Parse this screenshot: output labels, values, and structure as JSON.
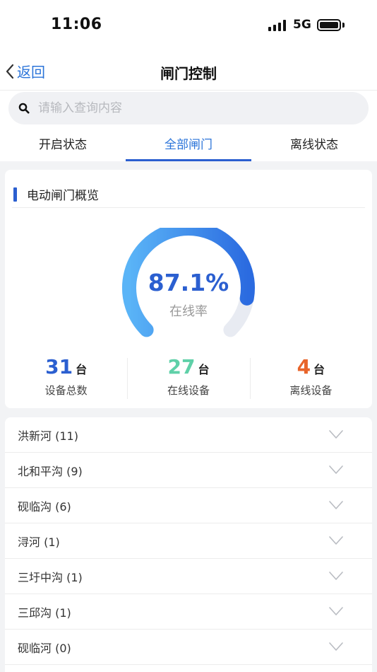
{
  "status_bar": {
    "time": "11:06",
    "network": "5G"
  },
  "nav": {
    "back_label": "返回",
    "title": "闸门控制"
  },
  "search": {
    "placeholder": "请输入查询内容"
  },
  "tabs": [
    {
      "label": "开启状态"
    },
    {
      "label": "全部闸门",
      "active": true
    },
    {
      "label": "离线状态"
    }
  ],
  "overview": {
    "title": "电动闸门概览",
    "gauge": {
      "value_text": "87.1%",
      "fraction": 0.871,
      "label": "在线率"
    },
    "stats": [
      {
        "value": "31",
        "unit": "台",
        "label": "设备总数",
        "color": "#2b5fd0"
      },
      {
        "value": "27",
        "unit": "台",
        "label": "在线设备",
        "color": "#5fd0a8"
      },
      {
        "value": "4",
        "unit": "台",
        "label": "离线设备",
        "color": "#e8642a"
      }
    ]
  },
  "gate_groups": [
    {
      "name": "洪新河 (11)"
    },
    {
      "name": "北和平沟 (9)"
    },
    {
      "name": "砚临沟 (6)"
    },
    {
      "name": "浔河 (1)"
    },
    {
      "name": "三圩中沟 (1)"
    },
    {
      "name": "三邱沟 (1)"
    },
    {
      "name": "砚临河 (0)"
    }
  ],
  "icons": {
    "back": "chevron-left-icon",
    "search": "search-icon",
    "expand": "chevron-down-icon"
  },
  "colors": {
    "accent": "#2b74d9",
    "gauge_start": "#5ab4f7",
    "gauge_end": "#2b6be0",
    "gauge_track": "#e8ebf2"
  }
}
